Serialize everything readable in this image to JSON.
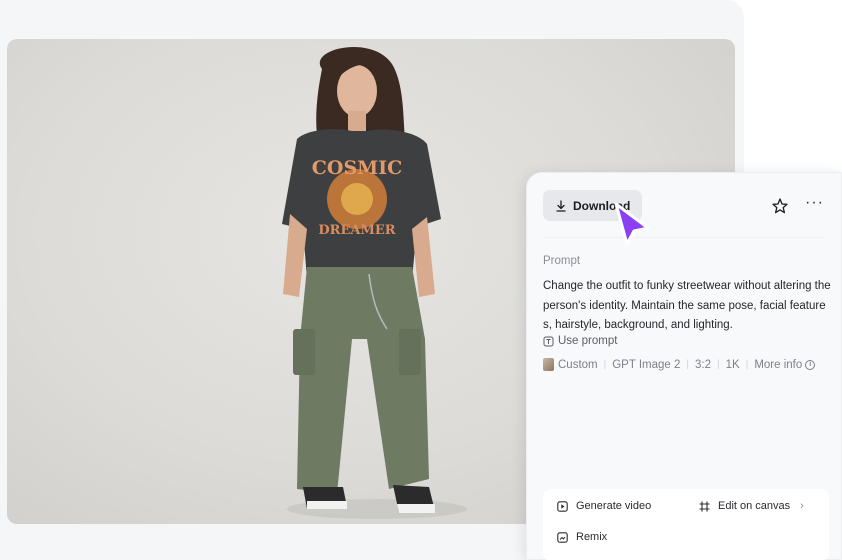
{
  "toolbar": {
    "download_label": "Download",
    "star_icon": "star-icon",
    "more_icon": "more-icon"
  },
  "prompt": {
    "label": "Prompt",
    "text": "Change the outfit to funky streetwear without altering the person's identity. Maintain the same pose, facial features, hairstyle, background, and lighting.",
    "use_label": "Use prompt"
  },
  "meta": {
    "style": "Custom",
    "model": "GPT Image 2",
    "ratio": "3:2",
    "resolution": "1K",
    "more_info": "More info"
  },
  "actions": {
    "generate_video": "Generate video",
    "edit_canvas": "Edit on canvas",
    "remix": "Remix"
  },
  "image": {
    "shirt_text_line1": "COSMIC",
    "shirt_text_line2": "DREAMER"
  },
  "colors": {
    "cursor": "#8b3ff5",
    "panel_bg": "#f8f9fb",
    "button_bg": "#e6e8ec"
  }
}
